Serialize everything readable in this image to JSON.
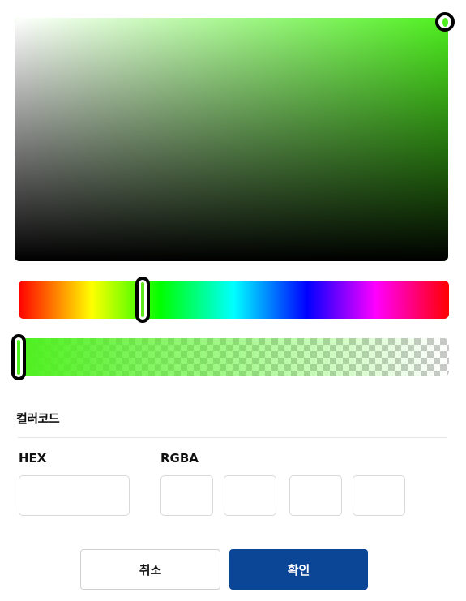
{
  "color_picker": {
    "current_color": "#4ef01e",
    "hue_color": "#00ff00",
    "hue_value": 0.29,
    "alpha_value": 1.0
  },
  "color_code": {
    "title": "컬러코드",
    "hex_label": "HEX",
    "rgba_label": "RGBA",
    "hex_value": "",
    "r_value": "",
    "g_value": "",
    "b_value": "",
    "a_value": ""
  },
  "buttons": {
    "cancel_label": "취소",
    "confirm_label": "확인"
  },
  "colors": {
    "confirm_bg": "#0a4596",
    "border": "#d9d9d9"
  }
}
